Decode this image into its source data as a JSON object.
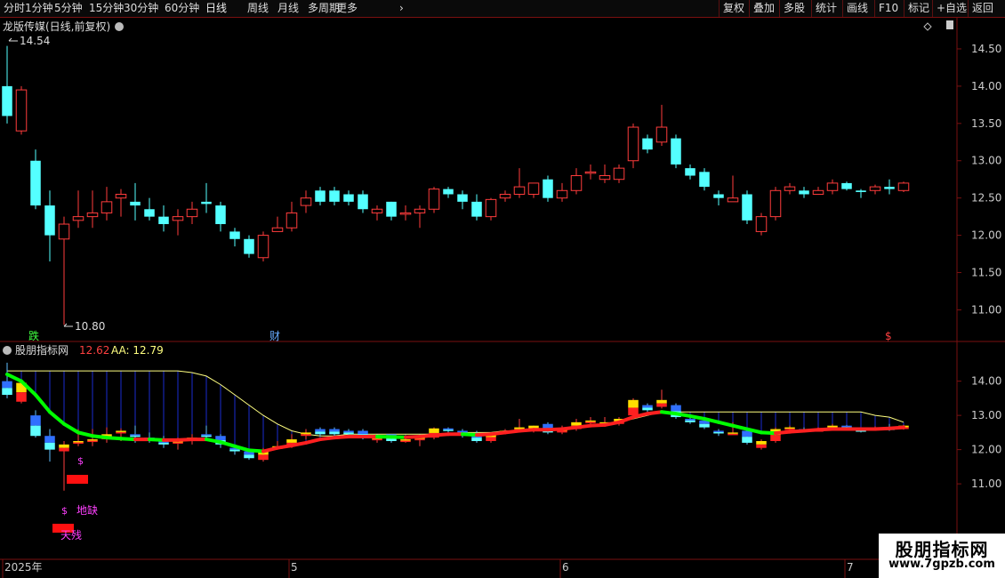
{
  "toolbar": {
    "periods": [
      "分时",
      "1分钟",
      "5分钟",
      "15分钟",
      "30分钟",
      "60分钟",
      "日线",
      "周线",
      "月线",
      "多周期",
      "更多"
    ],
    "active_period": "日线",
    "right_buttons": [
      "复权",
      "叠加",
      "多股",
      "统计",
      "画线",
      "F10",
      "标记",
      "+自选",
      "返回"
    ]
  },
  "main_panel": {
    "stock_title": "龙版传媒(日线,前复权)",
    "high_label": "14.54",
    "low_label": "10.80",
    "event_labels": [
      "跌",
      "财",
      "$"
    ]
  },
  "indicator_panel": {
    "name": "股朋指标网",
    "value": "12.62",
    "aa_label": "AA: 12.79",
    "signal_labels": [
      "$",
      "$",
      "地缺",
      "天残"
    ]
  },
  "date_axis": [
    "2025年",
    "5",
    "6",
    "7"
  ],
  "brand": {
    "title": "股朋指标网",
    "url": "www.7gpzb.com"
  },
  "colors": {
    "up": "#ff3c3c",
    "down": "#54ffff",
    "green_line": "#00ff00",
    "aa_line": "#ffff80",
    "grid": "#7a1010"
  },
  "chart_data": [
    {
      "type": "candlestick",
      "title": "龙版传媒(日线,前复权)",
      "ylim": [
        10.6,
        14.75
      ],
      "yticks": [
        11.0,
        11.5,
        12.0,
        12.5,
        13.0,
        13.5,
        14.0,
        14.5
      ],
      "series": [
        {
          "values": [
            [
              14.0,
              13.6,
              14.54,
              13.5
            ],
            [
              13.4,
              13.95,
              14.0,
              13.35
            ],
            [
              13.0,
              12.4,
              13.15,
              12.35
            ],
            [
              12.4,
              12.0,
              12.6,
              11.65
            ],
            [
              11.95,
              12.15,
              12.25,
              10.8
            ],
            [
              12.2,
              12.25,
              12.6,
              12.1
            ],
            [
              12.25,
              12.3,
              12.6,
              12.1
            ],
            [
              12.3,
              12.45,
              12.65,
              12.2
            ],
            [
              12.5,
              12.55,
              12.62,
              12.25
            ],
            [
              12.45,
              12.4,
              12.7,
              12.2
            ],
            [
              12.35,
              12.25,
              12.5,
              12.2
            ],
            [
              12.25,
              12.15,
              12.4,
              12.05
            ],
            [
              12.2,
              12.25,
              12.35,
              12.0
            ],
            [
              12.25,
              12.35,
              12.45,
              12.15
            ],
            [
              12.45,
              12.42,
              12.7,
              12.3
            ],
            [
              12.4,
              12.15,
              12.45,
              12.05
            ],
            [
              12.05,
              11.95,
              12.1,
              11.85
            ],
            [
              11.95,
              11.75,
              12.0,
              11.7
            ],
            [
              11.7,
              12.0,
              12.05,
              11.65
            ],
            [
              12.05,
              12.1,
              12.25,
              12.05
            ],
            [
              12.1,
              12.3,
              12.45,
              12.05
            ],
            [
              12.4,
              12.5,
              12.6,
              12.3
            ],
            [
              12.6,
              12.45,
              12.65,
              12.4
            ],
            [
              12.6,
              12.45,
              12.65,
              12.4
            ],
            [
              12.55,
              12.45,
              12.6,
              12.4
            ],
            [
              12.55,
              12.35,
              12.6,
              12.3
            ],
            [
              12.3,
              12.35,
              12.4,
              12.2
            ],
            [
              12.45,
              12.25,
              12.45,
              12.2
            ],
            [
              12.3,
              12.3,
              12.4,
              12.2
            ],
            [
              12.3,
              12.35,
              12.4,
              12.1
            ],
            [
              12.35,
              12.62,
              12.65,
              12.3
            ],
            [
              12.62,
              12.55,
              12.65,
              12.5
            ],
            [
              12.55,
              12.45,
              12.6,
              12.35
            ],
            [
              12.45,
              12.25,
              12.55,
              12.2
            ],
            [
              12.25,
              12.48,
              12.5,
              12.2
            ],
            [
              12.5,
              12.55,
              12.6,
              12.45
            ],
            [
              12.55,
              12.65,
              12.9,
              12.5
            ],
            [
              12.55,
              12.7,
              12.7,
              12.5
            ],
            [
              12.75,
              12.5,
              12.8,
              12.45
            ],
            [
              12.5,
              12.6,
              12.7,
              12.45
            ],
            [
              12.6,
              12.8,
              12.9,
              12.55
            ],
            [
              12.85,
              12.85,
              12.95,
              12.75
            ],
            [
              12.75,
              12.8,
              12.95,
              12.7
            ],
            [
              12.75,
              12.9,
              12.95,
              12.7
            ],
            [
              13.0,
              13.45,
              13.5,
              12.9
            ],
            [
              13.3,
              13.15,
              13.35,
              13.1
            ],
            [
              13.25,
              13.45,
              13.75,
              13.2
            ],
            [
              13.3,
              12.95,
              13.35,
              12.9
            ],
            [
              12.9,
              12.8,
              12.95,
              12.75
            ],
            [
              12.85,
              12.65,
              12.9,
              12.6
            ],
            [
              12.55,
              12.5,
              12.6,
              12.4
            ],
            [
              12.45,
              12.5,
              12.8,
              12.45
            ],
            [
              12.55,
              12.2,
              12.6,
              12.15
            ],
            [
              12.05,
              12.25,
              12.3,
              12.0
            ],
            [
              12.25,
              12.6,
              12.65,
              12.2
            ],
            [
              12.6,
              12.65,
              12.7,
              12.55
            ],
            [
              12.6,
              12.55,
              12.65,
              12.5
            ],
            [
              12.55,
              12.6,
              12.65,
              12.55
            ],
            [
              12.6,
              12.7,
              12.75,
              12.55
            ],
            [
              12.7,
              12.62,
              12.72,
              12.6
            ],
            [
              12.6,
              12.58,
              12.62,
              12.5
            ],
            [
              12.6,
              12.65,
              12.68,
              12.55
            ],
            [
              12.65,
              12.62,
              12.75,
              12.55
            ],
            [
              12.6,
              12.7,
              12.72,
              12.58
            ]
          ]
        }
      ]
    },
    {
      "type": "line",
      "title": "股朋指标网",
      "ylim": [
        9.6,
        14.9
      ],
      "yticks": [
        11.0,
        12.0,
        13.0,
        14.0
      ],
      "series": [
        {
          "name": "AA",
          "values": [
            14.3,
            14.3,
            14.3,
            14.3,
            14.3,
            14.3,
            14.3,
            14.3,
            14.3,
            14.3,
            14.3,
            14.3,
            14.3,
            14.25,
            14.15,
            13.9,
            13.6,
            13.3,
            13.0,
            12.75,
            12.55,
            12.45,
            12.4,
            12.4,
            12.45,
            12.45,
            12.45,
            12.45,
            12.45,
            12.45,
            12.45,
            12.45,
            12.5,
            12.5,
            12.5,
            12.55,
            12.55,
            12.6,
            12.6,
            12.6,
            12.65,
            12.7,
            12.75,
            12.8,
            12.9,
            13.0,
            13.1,
            13.1,
            13.1,
            13.1,
            13.1,
            13.1,
            13.1,
            13.1,
            13.1,
            13.1,
            13.1,
            13.1,
            13.1,
            13.1,
            13.1,
            13.0,
            12.95,
            12.8
          ]
        },
        {
          "values": [
            14.2,
            14.0,
            13.6,
            13.1,
            12.75,
            12.5,
            12.4,
            12.35,
            12.32,
            12.3,
            12.3,
            12.28,
            12.28,
            12.3,
            12.3,
            12.22,
            12.1,
            11.98,
            11.95,
            12.05,
            12.12,
            12.2,
            12.3,
            12.35,
            12.38,
            12.38,
            12.38,
            12.37,
            12.36,
            12.38,
            12.42,
            12.45,
            12.45,
            12.43,
            12.45,
            12.5,
            12.55,
            12.58,
            12.58,
            12.6,
            12.65,
            12.7,
            12.72,
            12.8,
            12.95,
            13.05,
            13.1,
            13.05,
            12.98,
            12.9,
            12.8,
            12.7,
            12.6,
            12.5,
            12.48,
            12.52,
            12.55,
            12.58,
            12.6,
            12.6,
            12.6,
            12.6,
            12.62,
            12.65
          ]
        }
      ]
    }
  ]
}
